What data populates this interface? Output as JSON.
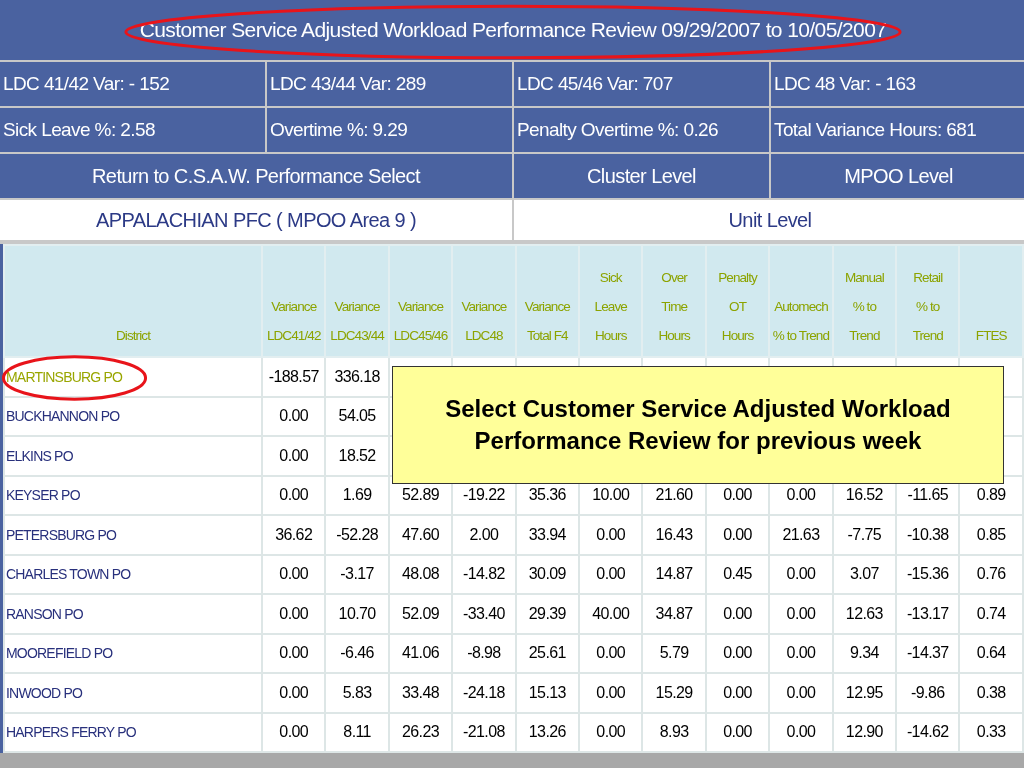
{
  "title": {
    "text": "Customer Service Adjusted Workload Performance Review 09/29/2007  to  10/05/2007",
    "circled": true
  },
  "summary_rows": [
    {
      "cells": [
        "LDC 41/42 Var:  - 152",
        "LDC 43/44 Var:  289",
        "LDC 45/46 Var:  707",
        "LDC 48 Var:  - 163"
      ]
    },
    {
      "cells": [
        "Sick Leave %: 2.58",
        "Overtime %: 9.29",
        "Penalty Overtime %: 0.26",
        "Total Variance Hours:  681"
      ]
    }
  ],
  "nav_links": [
    "Return to C.S.A.W. Performance Select",
    "Cluster Level",
    "MPOO Level"
  ],
  "area_row": {
    "area": "APPALACHIAN PFC   ( MPOO Area 9 )",
    "unit_level": "Unit Level"
  },
  "table": {
    "columns": [
      {
        "lines": [
          "District"
        ]
      },
      {
        "lines": [
          "Variance",
          "LDC41/42"
        ]
      },
      {
        "lines": [
          "Variance",
          "LDC43/44"
        ]
      },
      {
        "lines": [
          "Variance",
          "LDC45/46"
        ]
      },
      {
        "lines": [
          "Variance",
          "LDC48"
        ]
      },
      {
        "lines": [
          "Variance",
          "Total F4"
        ]
      },
      {
        "lines": [
          "Sick",
          "Leave",
          "Hours"
        ]
      },
      {
        "lines": [
          "Over",
          "Time",
          "Hours"
        ]
      },
      {
        "lines": [
          "Penalty",
          "OT",
          "Hours"
        ]
      },
      {
        "lines": [
          "Automech",
          "% to Trend"
        ]
      },
      {
        "lines": [
          "Manual",
          "% to",
          "Trend"
        ]
      },
      {
        "lines": [
          "Retail",
          "% to",
          "Trend"
        ]
      },
      {
        "lines": [
          "FTES"
        ]
      }
    ],
    "rows": [
      {
        "selected": true,
        "circled": true,
        "cells": [
          "MARTINSBURG PO",
          "-188.57",
          "336.18"
        ]
      },
      {
        "selected": false,
        "circled": false,
        "cells": [
          "BUCKHANNON PO",
          "0.00",
          "54.05"
        ]
      },
      {
        "selected": false,
        "circled": false,
        "cells": [
          "ELKINS PO",
          "0.00",
          "18.52"
        ]
      },
      {
        "selected": false,
        "circled": false,
        "cells": [
          "KEYSER PO",
          "0.00",
          "1.69",
          "52.89",
          "-19.22",
          "35.36",
          "10.00",
          "21.60",
          "0.00",
          "0.00",
          "16.52",
          "-11.65",
          "0.89"
        ]
      },
      {
        "selected": false,
        "circled": false,
        "cells": [
          "PETERSBURG PO",
          "36.62",
          "-52.28",
          "47.60",
          "2.00",
          "33.94",
          "0.00",
          "16.43",
          "0.00",
          "21.63",
          "-7.75",
          "-10.38",
          "0.85"
        ]
      },
      {
        "selected": false,
        "circled": false,
        "cells": [
          "CHARLES TOWN PO",
          "0.00",
          "-3.17",
          "48.08",
          "-14.82",
          "30.09",
          "0.00",
          "14.87",
          "0.45",
          "0.00",
          "3.07",
          "-15.36",
          "0.76"
        ]
      },
      {
        "selected": false,
        "circled": false,
        "cells": [
          "RANSON PO",
          "0.00",
          "10.70",
          "52.09",
          "-33.40",
          "29.39",
          "40.00",
          "34.87",
          "0.00",
          "0.00",
          "12.63",
          "-13.17",
          "0.74"
        ]
      },
      {
        "selected": false,
        "circled": false,
        "cells": [
          "MOOREFIELD PO",
          "0.00",
          "-6.46",
          "41.06",
          "-8.98",
          "25.61",
          "0.00",
          "5.79",
          "0.00",
          "0.00",
          "9.34",
          "-14.37",
          "0.64"
        ]
      },
      {
        "selected": false,
        "circled": false,
        "cells": [
          "INWOOD PO",
          "0.00",
          "5.83",
          "33.48",
          "-24.18",
          "15.13",
          "0.00",
          "15.29",
          "0.00",
          "0.00",
          "12.95",
          "-9.86",
          "0.38"
        ]
      },
      {
        "selected": false,
        "circled": false,
        "cells": [
          "HARPERS FERRY PO",
          "0.00",
          "8.11",
          "26.23",
          "-21.08",
          "13.26",
          "0.00",
          "8.93",
          "0.00",
          "0.00",
          "12.90",
          "-14.62",
          "0.33"
        ]
      }
    ]
  },
  "callout": {
    "text": "Select Customer Service Adjusted Workload Performance Review for previous week"
  }
}
